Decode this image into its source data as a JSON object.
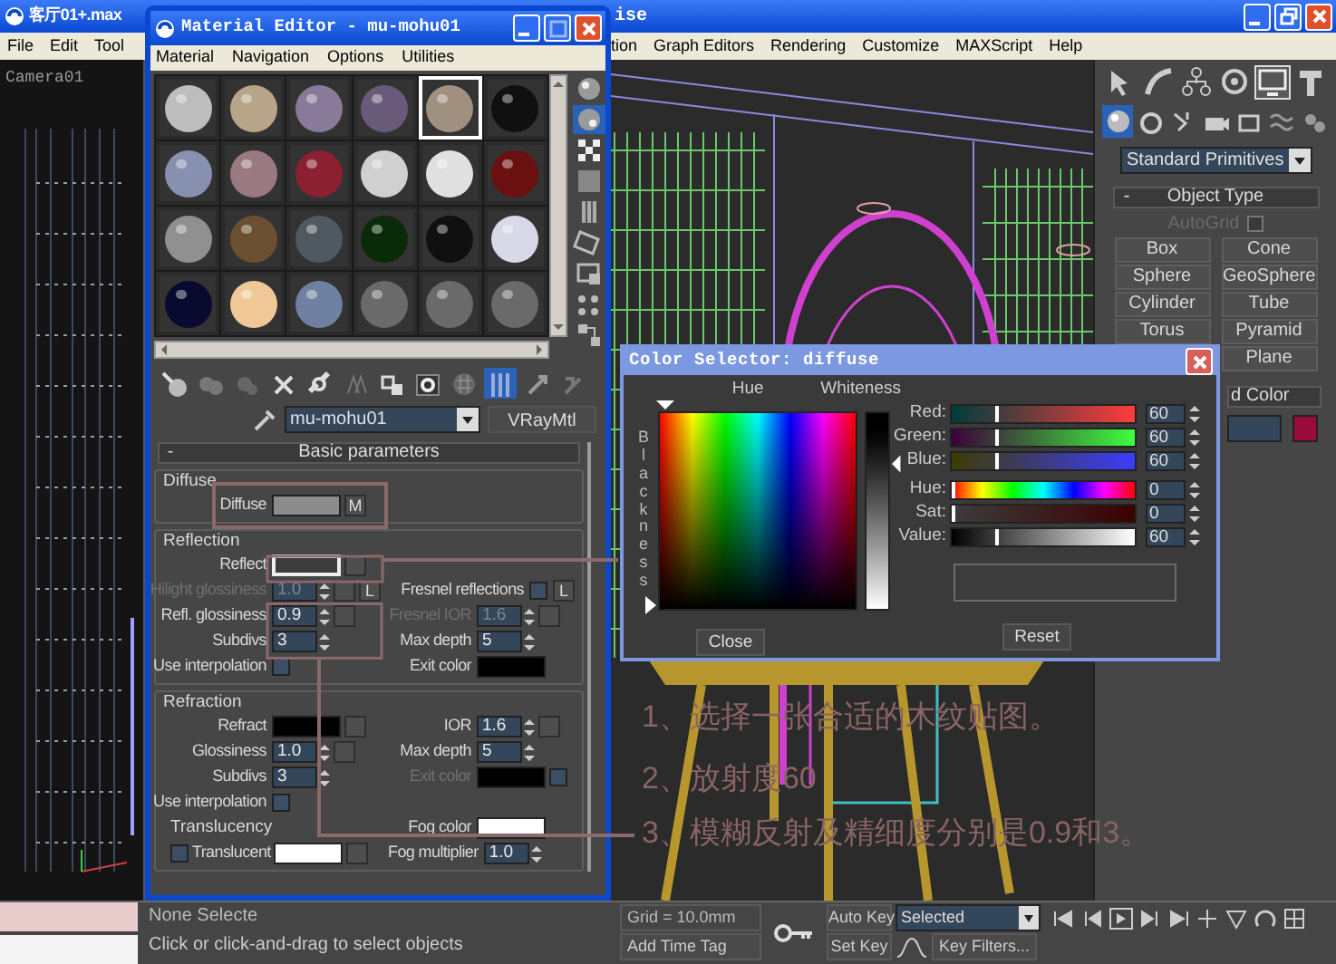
{
  "main_window": {
    "title": "客厅01+.max",
    "title_fragment": "ise",
    "menu_left": [
      "File",
      "Edit",
      "Tool"
    ],
    "menu_right": [
      "tion",
      "Graph Editors",
      "Rendering",
      "Customize",
      "MAXScript",
      "Help"
    ]
  },
  "left_viewport": {
    "label": "Camera01"
  },
  "command_panel": {
    "tabs": [
      {
        "selected": false
      },
      {
        "selected": false
      },
      {
        "selected": false
      },
      {
        "selected": false
      },
      {
        "selected": true
      },
      {
        "selected": false
      }
    ],
    "subtabs": [
      {
        "selected": true
      },
      {
        "selected": false
      },
      {
        "selected": false
      },
      {
        "selected": false
      },
      {
        "selected": false
      },
      {
        "selected": false
      },
      {
        "selected": false
      }
    ],
    "category": "Standard Primitives",
    "rollout": {
      "toggle": "-",
      "title": "Object Type"
    },
    "autogrid": {
      "label": "AutoGrid",
      "checked": false
    },
    "buttons": [
      "Box",
      "Cone",
      "Sphere",
      "GeoSphere",
      "Cylinder",
      "Tube",
      "Torus",
      "Pyramid",
      "Plane"
    ],
    "color_rollout": {
      "title": "d Color"
    },
    "swatch": {
      "color": "#9a0a3a"
    }
  },
  "material_editor": {
    "title": "Material Editor - mu-mohu01",
    "menu": [
      "Material",
      "Navigation",
      "Options",
      "Utilities"
    ],
    "slots": [
      {
        "color": "#bdbdbd",
        "selected": false
      },
      {
        "color": "#b8a488",
        "selected": false
      },
      {
        "color": "#8a7a9a",
        "selected": false
      },
      {
        "color": "#6a5a7a",
        "selected": false
      },
      {
        "color": "#a09080",
        "selected": true
      },
      {
        "color": "#101010",
        "selected": false
      },
      {
        "color": "#8890b0",
        "selected": false
      },
      {
        "color": "#9a7a80",
        "selected": false
      },
      {
        "color": "#8a2030",
        "selected": false
      },
      {
        "color": "#d0d0d0",
        "selected": false
      },
      {
        "color": "#e0e0e0",
        "selected": false
      },
      {
        "color": "#6a1010",
        "selected": false
      },
      {
        "color": "#909090",
        "selected": false
      },
      {
        "color": "#6a5030",
        "selected": false
      },
      {
        "color": "#505860",
        "selected": false
      },
      {
        "color": "#0a2a0a",
        "selected": false
      },
      {
        "color": "#101010",
        "selected": false
      },
      {
        "color": "#d8d8e8",
        "selected": false
      },
      {
        "color": "#0a0a30",
        "selected": false
      },
      {
        "color": "#f0c898",
        "selected": false
      },
      {
        "color": "#7080a0",
        "selected": false
      },
      {
        "color": "#6a6a6a",
        "selected": false
      },
      {
        "color": "#6a6a6a",
        "selected": false
      },
      {
        "color": "#6a6a6a",
        "selected": false
      }
    ],
    "side_toolbar": [
      {
        "selected": false
      },
      {
        "selected": true
      },
      {
        "selected": false
      },
      {
        "selected": false
      },
      {
        "selected": false
      },
      {
        "selected": false
      },
      {
        "selected": false
      },
      {
        "selected": false
      },
      {
        "selected": false
      }
    ],
    "bottom_toolbar": [
      {
        "selected": false
      },
      {
        "selected": false
      },
      {
        "selected": false
      },
      {
        "selected": false
      },
      {
        "selected": false
      },
      {
        "selected": false
      },
      {
        "selected": false
      },
      {
        "selected": false
      },
      {
        "selected": false
      },
      {
        "selected": true
      },
      {
        "selected": false
      },
      {
        "selected": false
      }
    ],
    "material_name": "mu-mohu01",
    "material_type": "VRayMtl",
    "rollout": {
      "toggle": "-",
      "title": "Basic parameters"
    },
    "groups": [
      {
        "title": "Diffuse",
        "rows": [
          {
            "left": [
              {
                "kind": "label",
                "text": "Diffuse",
                "disabled": false
              },
              {
                "kind": "swatch",
                "color": "#8c8c8c",
                "selected": false
              },
              {
                "kind": "button",
                "text": "M"
              }
            ]
          }
        ]
      },
      {
        "title": "Reflection",
        "rows": [
          {
            "left": [
              {
                "kind": "label",
                "text": "Reflect",
                "disabled": false
              },
              {
                "kind": "swatch",
                "color": "#3c3c3c",
                "selected": true
              },
              {
                "kind": "button"
              }
            ]
          },
          {
            "left": [
              {
                "kind": "label",
                "text": "Hilight glossiness",
                "disabled": true
              },
              {
                "kind": "spinner",
                "value": "1.0",
                "disabled": true
              },
              {
                "kind": "button"
              },
              {
                "kind": "button",
                "text": "L"
              }
            ],
            "right": [
              {
                "kind": "label",
                "text": "Fresnel reflections",
                "disabled": false
              },
              {
                "kind": "checkbox",
                "checked": false
              },
              {
                "kind": "button",
                "text": "L"
              }
            ]
          },
          {
            "left": [
              {
                "kind": "label",
                "text": "Refl. glossiness",
                "disabled": false
              },
              {
                "kind": "spinner",
                "value": "0.9",
                "disabled": false
              },
              {
                "kind": "button"
              }
            ],
            "right": [
              {
                "kind": "label",
                "text": "Fresnel IOR",
                "disabled": true
              },
              {
                "kind": "spinner",
                "value": "1.6",
                "disabled": true
              },
              {
                "kind": "button"
              }
            ]
          },
          {
            "left": [
              {
                "kind": "label",
                "text": "Subdivs",
                "disabled": false
              },
              {
                "kind": "spinner",
                "value": "3",
                "disabled": false
              }
            ],
            "right": [
              {
                "kind": "label",
                "text": "Max depth",
                "disabled": false
              },
              {
                "kind": "spinner",
                "value": "5",
                "disabled": false
              }
            ]
          },
          {
            "left": [
              {
                "kind": "label",
                "text": "Use interpolation",
                "disabled": false
              },
              {
                "kind": "checkbox",
                "checked": false
              }
            ],
            "right": [
              {
                "kind": "label",
                "text": "Exit color",
                "disabled": false
              },
              {
                "kind": "swatch",
                "color": "#000000",
                "selected": false
              }
            ]
          }
        ]
      },
      {
        "title": "Refraction",
        "rows": [
          {
            "left": [
              {
                "kind": "label",
                "text": "Refract",
                "disabled": false
              },
              {
                "kind": "swatch",
                "color": "#000000",
                "selected": false
              },
              {
                "kind": "button"
              }
            ],
            "right": [
              {
                "kind": "label",
                "text": "IOR",
                "disabled": false
              },
              {
                "kind": "spinner",
                "value": "1.6",
                "disabled": false
              },
              {
                "kind": "button"
              }
            ]
          },
          {
            "left": [
              {
                "kind": "label",
                "text": "Glossiness",
                "disabled": false
              },
              {
                "kind": "spinner",
                "value": "1.0",
                "disabled": false
              },
              {
                "kind": "button"
              }
            ],
            "right": [
              {
                "kind": "label",
                "text": "Max depth",
                "disabled": false
              },
              {
                "kind": "spinner",
                "value": "5",
                "disabled": false
              }
            ]
          },
          {
            "left": [
              {
                "kind": "label",
                "text": "Subdivs",
                "disabled": false
              },
              {
                "kind": "spinner",
                "value": "3",
                "disabled": false
              }
            ],
            "right": [
              {
                "kind": "label",
                "text": "Exit color",
                "disabled": true
              },
              {
                "kind": "swatch",
                "color": "#000000",
                "selected": false
              },
              {
                "kind": "checkbox",
                "checked": false
              }
            ]
          },
          {
            "left": [
              {
                "kind": "label",
                "text": "Use interpolation",
                "disabled": false
              },
              {
                "kind": "checkbox",
                "checked": false
              }
            ]
          },
          {
            "left": [
              {
                "kind": "subtitle",
                "text": "Translucency"
              }
            ],
            "right": [
              {
                "kind": "label",
                "text": "Fog color",
                "disabled": false
              },
              {
                "kind": "swatch",
                "color": "#ffffff",
                "selected": false
              }
            ]
          },
          {
            "left": [
              {
                "kind": "checkbox",
                "checked": false
              },
              {
                "kind": "label",
                "text": "Translucent",
                "disabled": false
              },
              {
                "kind": "swatch",
                "color": "#ffffff",
                "selected": false
              },
              {
                "kind": "button"
              }
            ],
            "right": [
              {
                "kind": "label",
                "text": "Fog multiplier",
                "disabled": false
              },
              {
                "kind": "spinner",
                "value": "1.0",
                "disabled": false
              }
            ]
          }
        ]
      }
    ]
  },
  "color_selector": {
    "title": "Color Selector: diffuse",
    "hue_label": "Hue",
    "whiteness_label": "Whiteness",
    "blackness_label": "Blackness",
    "rgb": [
      {
        "kind": "red",
        "label": "Red:",
        "value": "60",
        "level": 0.235
      },
      {
        "kind": "green",
        "label": "Green:",
        "value": "60",
        "level": 0.235
      },
      {
        "kind": "blue",
        "label": "Blue:",
        "value": "60",
        "level": 0.235
      }
    ],
    "hsv": [
      {
        "kind": "hue",
        "label": "Hue:",
        "value": "0",
        "level": 0
      },
      {
        "kind": "sat",
        "label": "Sat:",
        "value": "0",
        "level": 0
      },
      {
        "kind": "value",
        "label": "Value:",
        "value": "60",
        "level": 0.235
      }
    ],
    "close": "Close",
    "reset": "Reset"
  },
  "annotations": [
    {
      "text": "1、选择一张合适的木纹贴图。"
    },
    {
      "text": "2、放射度60"
    },
    {
      "text": "3、模糊反射及精细度分别是0.9和3。"
    }
  ],
  "status_bar": {
    "selection": "None Selecte",
    "prompt": "Click or click-and-drag to select objects",
    "grid": "Grid = 10.0mm",
    "time_tag": "Add Time Tag",
    "auto_key": "Auto Key",
    "key_mode": "Selected",
    "set_key": "Set Key",
    "key_filters": "Key Filters..."
  }
}
